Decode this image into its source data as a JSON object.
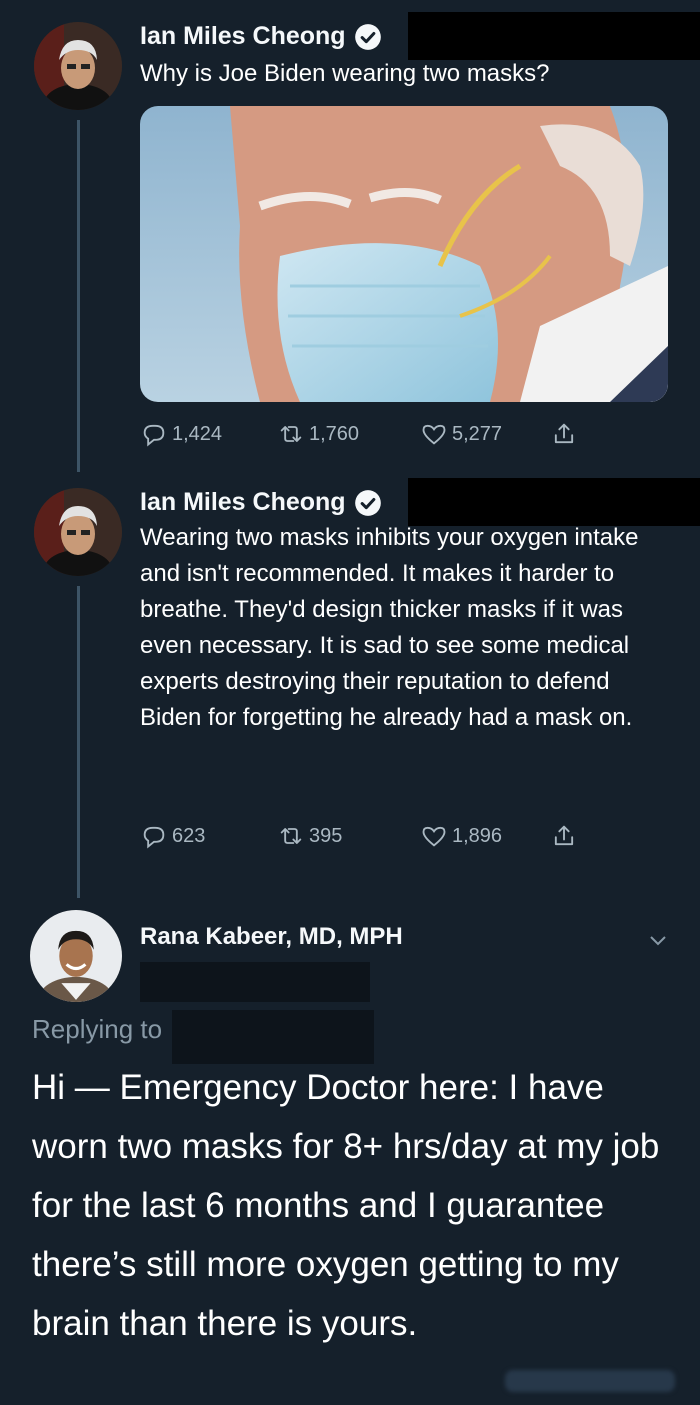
{
  "colors": {
    "background": "#15202b",
    "thread_line": "#3d5466",
    "verified": "#1da1f2",
    "meta_text": "#aab8c2",
    "redaction": "#000000"
  },
  "tweets": [
    {
      "author": "Ian Miles Cheong",
      "verified": true,
      "text": "Why is Joe Biden wearing two masks?",
      "has_media": true,
      "stats": {
        "replies": "1,424",
        "retweets": "1,760",
        "likes": "5,277"
      }
    },
    {
      "author": "Ian Miles Cheong",
      "verified": true,
      "text": "Wearing two masks inhibits your oxygen intake and isn't  recommended. It makes it harder to breathe. They'd design thicker masks if it was even necessary. It is sad to see some medical experts destroying their reputation to defend Biden for forgetting he already had a mask on.",
      "stats": {
        "replies": "623",
        "retweets": "395",
        "likes": "1,896"
      }
    }
  ],
  "reply": {
    "author": "Rana Kabeer, MD, MPH",
    "replying_to_label": "Replying to",
    "text": "Hi — Emergency Doctor here: I have worn two masks for 8+ hrs/day at my job for the last 6 months and I guarantee there’s still more oxygen getting to my brain than there is yours."
  }
}
